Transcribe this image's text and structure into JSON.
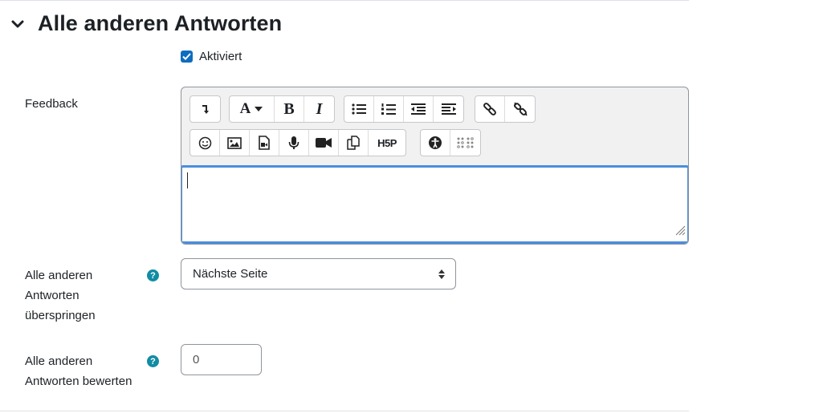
{
  "section": {
    "title": "Alle anderen Antworten"
  },
  "enabled": {
    "label": "Aktiviert",
    "checked": true
  },
  "feedback": {
    "label": "Feedback"
  },
  "skip": {
    "label_lines": [
      "Alle anderen",
      "Antworten",
      "überspringen"
    ],
    "selected": "Nächste Seite"
  },
  "score": {
    "label_lines": [
      "Alle anderen",
      "Antworten bewerten"
    ],
    "value": "0"
  },
  "toolbar": {
    "row1": [
      "show-more-icon",
      "font-color-icon",
      "bold-icon",
      "italic-icon",
      "unordered-list-icon",
      "ordered-list-icon",
      "outdent-icon",
      "indent-icon",
      "link-icon",
      "unlink-icon"
    ],
    "row2": [
      "emoji-icon",
      "image-icon",
      "media-icon",
      "record-audio-icon",
      "record-video-icon",
      "manage-files-icon",
      "h5p-icon",
      "accessibility-checker-icon",
      "screenreader-helper-icon"
    ],
    "bold_glyph": "B",
    "italic_glyph": "I",
    "font_glyph": "A",
    "h5p_glyph": "H5P"
  },
  "colors": {
    "accent": "#0f6cbf",
    "help_teal": "#118ca3",
    "focus": "#4c8ddd"
  }
}
